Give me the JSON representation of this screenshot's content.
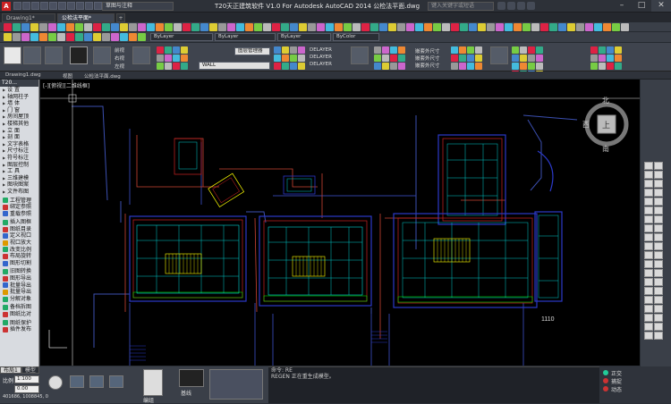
{
  "titlebar": {
    "title": "T20天正建筑软件 V1.0 For Autodesk AutoCAD 2014    公检法平面.dwg",
    "workspace": "草图与注释",
    "search_placeholder": "键入关键字或短语"
  },
  "tabs": [
    {
      "label": "Drawing1*"
    },
    {
      "label": "公检法平面*"
    },
    {
      "label": "公检法平面*"
    }
  ],
  "layer": {
    "current": "ByLayer",
    "linetype": "ByLayer",
    "lineweight": "ByLayer",
    "color": "ByColor",
    "ribbon_layer": "WALL",
    "ribbon_labels": [
      "前视",
      "右视",
      "左视"
    ],
    "delayer": [
      "DELAYER",
      "DELAYER",
      "DELAYER"
    ],
    "match_labels": [
      "嵌套外尺寸",
      "嵌套外尺寸",
      "嵌套外尺寸"
    ],
    "standard": "图层管理器"
  },
  "panel_bar": {
    "view_label": "Drawing1.dwg",
    "panel1": "视图",
    "panel2": "公检法平面.dwg"
  },
  "viewport_label": "[-][俯视][二维线框]",
  "sidebar": {
    "header": "T20...",
    "items": [
      "设  置",
      "轴网柱子",
      "墙  体",
      "门  窗",
      "房间屋顶",
      "楼梯其他",
      "立  面",
      "剖  面",
      "文字表格",
      "尺寸标注",
      "符号标注",
      "图层控制",
      "工  具",
      "三维建模",
      "图块图案",
      "文件布图"
    ],
    "items2": [
      "工程管理",
      "绑定参照",
      "重载参照"
    ],
    "items3": [
      "插入图框",
      "图纸目录",
      "定义视口",
      "视口放大",
      "改变比例",
      "布局旋转",
      "图形切割"
    ],
    "items4": [
      "旧图转换",
      "图形导出",
      "批量导出",
      "批量导出",
      "分解对象"
    ],
    "items5": [
      "备档拆图",
      "图纸比对"
    ],
    "items6": [
      "图纸保护",
      "插件发布"
    ]
  },
  "drawing": {
    "annotation_1110": "1110",
    "compass": {
      "n": "北",
      "w": "西",
      "s": "南",
      "center": "上",
      "wcs": "WCS"
    }
  },
  "status": {
    "model_tabs": [
      "布局1",
      "模型"
    ],
    "scale_label": "比例",
    "scale_value": "1:100",
    "coords": "401686, 1008845, 0",
    "elevation": "0.00",
    "grid_label": "基线",
    "btn1": "编组"
  },
  "command": {
    "line1": "命令: RE",
    "line2": "REGEN 正在重生成模型。"
  },
  "right_status": {
    "ortho": "正交",
    "snap": "捕捉",
    "dynamic": "动态"
  }
}
